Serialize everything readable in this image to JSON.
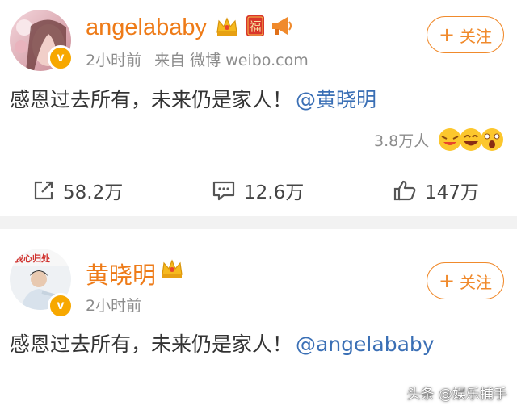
{
  "posts": [
    {
      "username": "angelababy",
      "time": "2小时前",
      "source": "来自 微博 weibo.com",
      "follow_label": "关注",
      "content": "感恩过去所有，未来仍是家人！",
      "mention": "@黄晓明",
      "reaction_count": "3.8万人",
      "actions": {
        "repost": "58.2万",
        "comment": "12.6万",
        "like": "147万"
      },
      "badge_text": "福"
    },
    {
      "username": "黄晓明",
      "time": "2小时前",
      "follow_label": "关注",
      "content": "感恩过去所有，未来仍是家人！",
      "mention": "@angelababy",
      "avatar_text": "我心归处"
    }
  ],
  "watermark": "头条 @娱乐捕手",
  "colors": {
    "username": "#ee7b18",
    "mention": "#3a6fb5",
    "follow": "#f08a2c",
    "verified": "#f7a800"
  }
}
